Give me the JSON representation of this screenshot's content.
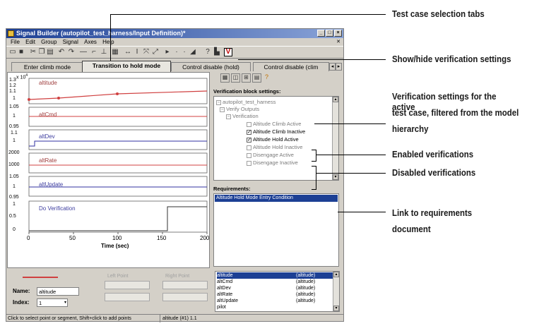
{
  "window": {
    "title": "Signal Builder (autopilot_test_harness/Input Definition)*",
    "menu": [
      "File",
      "Edit",
      "Group",
      "Signal",
      "Axes",
      "Help"
    ],
    "toolbar_icons": [
      "open-icon",
      "save-icon",
      "cut-icon",
      "copy-icon",
      "paste-icon",
      "undo-icon",
      "redo-icon",
      "line-icon",
      "step-icon",
      "pulse-icon",
      "grid-icon",
      "snap-icon",
      "move-icon",
      "zoom-icon",
      "play-icon",
      "stop-icon",
      "step-back-icon",
      "step-fwd-icon",
      "scope-icon",
      "help-icon",
      "requirements-icon",
      "verify-icon"
    ],
    "verify_button_label": "V"
  },
  "tabs": [
    {
      "label": "Enter climb mode",
      "active": false
    },
    {
      "label": "Transition to hold mode",
      "active": true
    },
    {
      "label": "Control disable (hold)",
      "active": false
    },
    {
      "label": "Control disable (clim",
      "active": false
    }
  ],
  "plot": {
    "top_exponent_label": "x 10",
    "exponent": "4",
    "signals": [
      {
        "name": "altitude",
        "ticks": [
          "1.3",
          "1.2",
          "1.1",
          "1"
        ]
      },
      {
        "name": "altCmd",
        "ticks": [
          "1.05",
          "1"
        ]
      },
      {
        "name": "altDev",
        "ticks": [
          "0.95",
          "1.1",
          "1"
        ]
      },
      {
        "name": "altRate",
        "ticks": [
          "2000",
          "1000"
        ]
      },
      {
        "name": "altUpdate",
        "ticks": [
          "1.05",
          "1"
        ]
      },
      {
        "name": "Do Verification",
        "ticks": [
          "0.95",
          "1",
          "0.5",
          "0"
        ]
      }
    ],
    "x_ticks": [
      "0",
      "50",
      "100",
      "150",
      "200"
    ],
    "x_label": "Time (sec)"
  },
  "verification": {
    "header": "Verification block settings:",
    "tree": [
      {
        "label": "autopilot_test_harness",
        "state": "folder",
        "enabled": false
      },
      {
        "label": "Verify Outputs",
        "state": "folder",
        "enabled": false
      },
      {
        "label": "Verification",
        "state": "folder",
        "enabled": false
      },
      {
        "label": "Altitude Climb Active",
        "state": "unchecked",
        "enabled": false
      },
      {
        "label": "Altitude Climb Inactive",
        "state": "checked",
        "enabled": true
      },
      {
        "label": "Altitude Hold Active",
        "state": "checked",
        "enabled": true
      },
      {
        "label": "Altitude Hold Inactive",
        "state": "unchecked",
        "enabled": false
      },
      {
        "label": "Disengage Active",
        "state": "unchecked",
        "enabled": false
      },
      {
        "label": "Disengage Inactive",
        "state": "unchecked",
        "enabled": false
      }
    ],
    "requirements_header": "Requirements:",
    "requirement_item": "Altitude Hold Mode Entry Condition"
  },
  "bottom": {
    "name_label": "Name:",
    "name_value": "altitude",
    "index_label": "Index:",
    "index_value": "1",
    "left_point_label": "Left Point",
    "right_point_label": "Right Point",
    "signal_list": [
      {
        "name": "altitude",
        "unit": "(altitude)",
        "selected": true
      },
      {
        "name": "altCmd",
        "unit": "(altitude)",
        "selected": false
      },
      {
        "name": "altDev",
        "unit": "(altitude)",
        "selected": false
      },
      {
        "name": "altRate",
        "unit": "(altitude)",
        "selected": false
      },
      {
        "name": "altUpdate",
        "unit": "(altitude)",
        "selected": false
      },
      {
        "name": "pilot",
        "unit": "",
        "selected": false
      }
    ],
    "status_left": "Click to select point or segment, Shift+click to add points",
    "status_right": "altitude (#1) 1.1"
  },
  "callouts": {
    "tabs": "Test case selection tabs",
    "show_hide": "Show/hide verification settings",
    "settings": [
      "Verification settings for the active",
      "test case, filtered from the model",
      "hierarchy"
    ],
    "enabled": "Enabled verifications",
    "disabled": "Disabled verifications",
    "link": [
      "Link to requirements",
      "document"
    ]
  },
  "colors": {
    "signal_line": "#d04040",
    "label_text": "#4040a0",
    "selection": "#1c3f94"
  }
}
